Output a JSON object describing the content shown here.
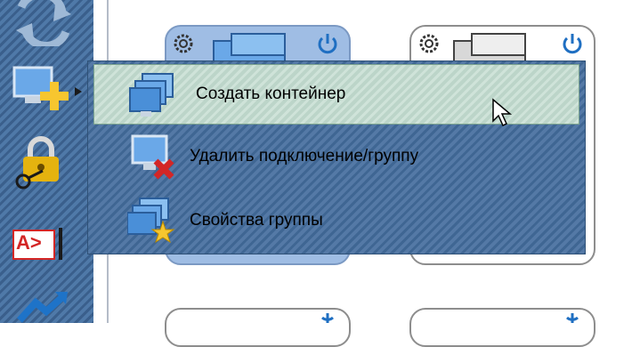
{
  "colors": {
    "sidebar_stripe_a": "#3a5f8c",
    "sidebar_stripe_b": "#4f79a8",
    "menu_bg": "#4a6f9d",
    "highlight": "#c6ddd1",
    "selected_card": "#9fbde4",
    "power_blue": "#1f6fc2",
    "delete_red": "#d32626",
    "lock_gold": "#e5b30f"
  },
  "sidebar": {
    "icons": [
      {
        "name": "refresh-icon"
      },
      {
        "name": "add-screen-icon"
      },
      {
        "name": "lock-key-icon"
      },
      {
        "name": "text-input-icon",
        "label": "A>"
      },
      {
        "name": "redirect-arrow-icon"
      }
    ]
  },
  "cards": [
    {
      "name": "connection-card-1",
      "selected": true
    },
    {
      "name": "connection-card-2",
      "selected": false
    },
    {
      "name": "connection-card-3",
      "selected": false
    },
    {
      "name": "connection-card-4",
      "selected": false
    }
  ],
  "context_menu": {
    "items": [
      {
        "label": "Создать контейнер",
        "icon": "monitors-stack-icon",
        "highlighted": true
      },
      {
        "label": "Удалить подключение/группу",
        "icon": "monitor-delete-icon",
        "highlighted": false
      },
      {
        "label": "Свойства группы",
        "icon": "monitors-properties-icon",
        "highlighted": false
      }
    ]
  }
}
